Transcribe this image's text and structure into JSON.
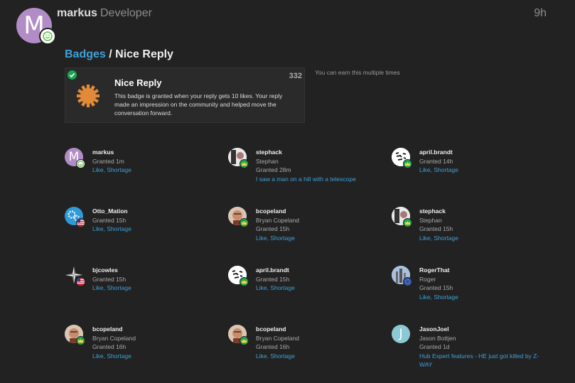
{
  "header": {
    "avatar_letter": "M",
    "username": "markus",
    "role": "Developer",
    "time": "9h"
  },
  "breadcrumb": {
    "parent": "Badges",
    "separator": " / ",
    "current": "Nice Reply"
  },
  "badge": {
    "name": "Nice Reply",
    "count": "332",
    "description": "This badge is granted when your reply gets 10 likes. Your reply made an impression on the community and helped move the conversation forward.",
    "multiple_note": "You can earn this multiple times",
    "icon_color": "#e08a3a",
    "check_color": "#1ca551"
  },
  "grants": [
    {
      "username": "markus",
      "fullname": "",
      "granted": "Granted 1m",
      "link": "Like, Shortage"
    },
    {
      "username": "stephack",
      "fullname": "Stephan",
      "granted": "Granted 28m",
      "link": "I saw a man on a hill with a telescope"
    },
    {
      "username": "april.brandt",
      "fullname": "",
      "granted": "Granted 14h",
      "link": "Like, Shortage"
    },
    {
      "username": "Otto_Mation",
      "fullname": "",
      "granted": "Granted 15h",
      "link": "Like, Shortage"
    },
    {
      "username": "bcopeland",
      "fullname": "Bryan Copeland",
      "granted": "Granted 15h",
      "link": "Like, Shortage"
    },
    {
      "username": "stephack",
      "fullname": "Stephan",
      "granted": "Granted 15h",
      "link": "Like, Shortage"
    },
    {
      "username": "bjcowles",
      "fullname": "",
      "granted": "Granted 15h",
      "link": "Like, Shortage"
    },
    {
      "username": "april.brandt",
      "fullname": "",
      "granted": "Granted 15h",
      "link": "Like, Shortage"
    },
    {
      "username": "RogerThat",
      "fullname": "Roger",
      "granted": "Granted 15h",
      "link": "Like, Shortage"
    },
    {
      "username": "bcopeland",
      "fullname": "Bryan Copeland",
      "granted": "Granted 16h",
      "link": "Like, Shortage"
    },
    {
      "username": "bcopeland",
      "fullname": "Bryan Copeland",
      "granted": "Granted 16h",
      "link": "Like, Shortage"
    },
    {
      "username": "JasonJoel",
      "fullname": "Jason Bottjen",
      "granted": "Granted 1d",
      "link": "Hub Expert features - HE just got killed by Z-WAY"
    }
  ]
}
